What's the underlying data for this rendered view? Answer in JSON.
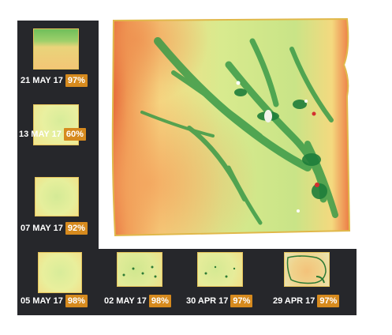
{
  "colors": {
    "panel_bg": "#26272b",
    "badge_bg": "#d68a1e",
    "field_edge": "#e4c25a",
    "low": "#e0452a",
    "mid": "#f5e07a",
    "high": "#1e8a3c"
  },
  "selected_index": 0,
  "timeline": [
    {
      "date": "21 MAY 17",
      "cloud_free": "97%",
      "thumb_style": "top-green"
    },
    {
      "date": "13 MAY 17",
      "cloud_free": "60%",
      "thumb_style": "light-green"
    },
    {
      "date": "07 MAY 17",
      "cloud_free": "92%",
      "thumb_style": "light-green"
    },
    {
      "date": "05 MAY 17",
      "cloud_free": "98%",
      "thumb_style": "light-green"
    },
    {
      "date": "02 MAY 17",
      "cloud_free": "98%",
      "thumb_style": "speckled"
    },
    {
      "date": "30 APR 17",
      "cloud_free": "97%",
      "thumb_style": "speckled"
    },
    {
      "date": "29 APR 17",
      "cloud_free": "97%",
      "thumb_style": "bare-soil"
    }
  ],
  "icons": {
    "main_map": "ndvi-field-map"
  }
}
